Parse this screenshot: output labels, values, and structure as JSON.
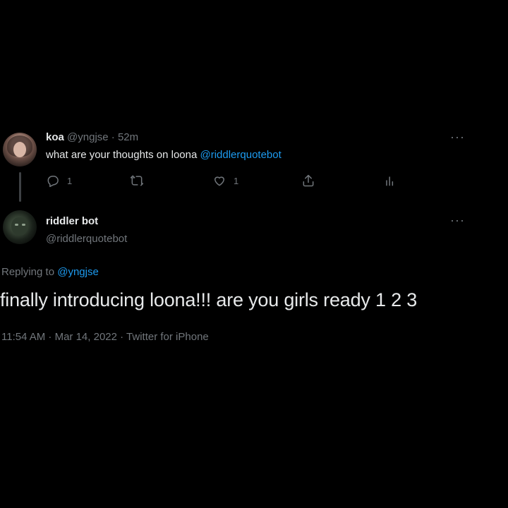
{
  "parent_tweet": {
    "display_name": "koa",
    "handle": "@yngjse",
    "separator": " · ",
    "time_ago": "52m",
    "text_plain": "what are your thoughts on loona ",
    "text_mention": "@riddlerquotebot",
    "more_label": "···",
    "reply_count": "1",
    "like_count": "1",
    "icons": {
      "reply": "reply-icon",
      "retweet": "retweet-icon",
      "like": "heart-icon",
      "share": "share-icon",
      "stats": "stats-icon"
    }
  },
  "main_tweet": {
    "display_name": "riddler bot",
    "handle": "@riddlerquotebot",
    "more_label": "···",
    "replying_label": "Replying to ",
    "replying_handle": "@yngjse",
    "text": "finally introducing loona!!! are you girls ready 1 2 3",
    "timestamp": "11:54 AM · Mar 14, 2022 · Twitter for iPhone"
  },
  "colors": {
    "background": "#000000",
    "text": "#e7e9ea",
    "muted": "#71767b",
    "link": "#1d9bf0"
  }
}
